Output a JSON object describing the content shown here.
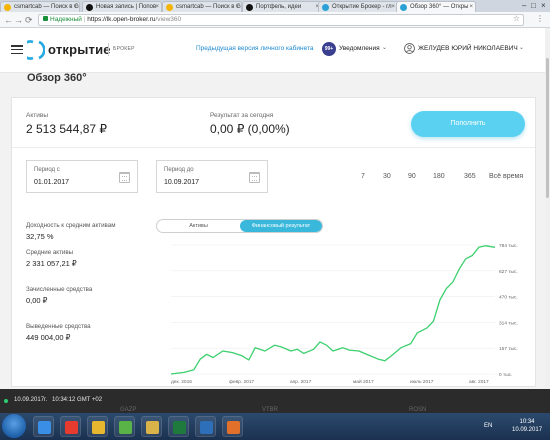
{
  "browser": {
    "tabs": [
      {
        "label": "csmartcab — Поиск в G",
        "active": false,
        "color": "#f4b400"
      },
      {
        "label": "Новая запись | Попов",
        "active": false,
        "color": "#111111"
      },
      {
        "label": "csmartcab — Поиск в G",
        "active": false,
        "color": "#f4b400"
      },
      {
        "label": "Портфель, идеи",
        "active": false,
        "color": "#111111"
      },
      {
        "label": "Открытие Брокер - гл",
        "active": false,
        "color": "#2aa1d6"
      },
      {
        "label": "Обзор 360° — Откры",
        "active": true,
        "color": "#2aa1d6"
      }
    ],
    "tab_close": "×",
    "url_secure_label": "Надежный",
    "url_host": "https://lk.open-broker.ru",
    "url_path": "/view360"
  },
  "header": {
    "logo_text": "открытие",
    "logo_sub": "БРОКЕР",
    "prev_cabinet_link": "Предыдущая версия личного кабинета",
    "notif_badge": "99+",
    "notif_label": "Уведомления",
    "user_name": "ЖЕЛУДЕВ ЮРИЙ НИКОЛАЕВИЧ"
  },
  "page": {
    "title": "Обзор 360°",
    "assets_label": "Активы",
    "assets_value": "2 513 544,87 ₽",
    "result_label": "Результат за сегодня",
    "result_value": "0,00 ₽ (0,00%)",
    "topup_button": "Пополнить",
    "date_from_label": "Период с",
    "date_from_value": "01.01.2017",
    "date_to_label": "Период до",
    "date_to_value": "10.09.2017",
    "periods": [
      "7",
      "30",
      "90",
      "180",
      "365",
      "Всё время"
    ],
    "stats": [
      {
        "label": "Доходность к средним активам",
        "value": "32,75 %"
      },
      {
        "label": "Средние активы",
        "value": "2 331 057,21 ₽"
      },
      {
        "label": "Зачисленные средства",
        "value": "0,00 ₽"
      },
      {
        "label": "Выведенные средства",
        "value": "449 004,00 ₽"
      }
    ],
    "toggle": {
      "assets": "Активы",
      "financial": "Финансовый результат",
      "selected": "financial"
    }
  },
  "chart_data": {
    "type": "line",
    "color": "#3ccf6e",
    "x_labels": [
      "дек. 2016",
      "февр. 2017",
      "апр. 2017",
      "май 2017",
      "июль 2017",
      "авг. 2017"
    ],
    "y_ticks": [
      {
        "value": 0,
        "label": "0 тыс."
      },
      {
        "value": 157,
        "label": "157 тыс."
      },
      {
        "value": 314,
        "label": "314 тыс."
      },
      {
        "value": 470,
        "label": "470 тыс."
      },
      {
        "value": 627,
        "label": "627 тыс."
      },
      {
        "value": 784,
        "label": "784 тыс."
      }
    ],
    "ylim": [
      0,
      784
    ],
    "x_range": [
      0,
      100
    ],
    "points": [
      [
        0,
        0
      ],
      [
        4,
        10
      ],
      [
        7,
        25
      ],
      [
        9,
        90
      ],
      [
        11,
        120
      ],
      [
        13,
        100
      ],
      [
        16,
        140
      ],
      [
        19,
        130
      ],
      [
        22,
        110
      ],
      [
        24,
        85
      ],
      [
        26,
        160
      ],
      [
        29,
        140
      ],
      [
        32,
        175
      ],
      [
        34,
        165
      ],
      [
        37,
        140
      ],
      [
        39,
        150
      ],
      [
        41,
        125
      ],
      [
        44,
        150
      ],
      [
        46,
        195
      ],
      [
        48,
        175
      ],
      [
        50,
        140
      ],
      [
        53,
        160
      ],
      [
        55,
        145
      ],
      [
        58,
        140
      ],
      [
        61,
        115
      ],
      [
        64,
        90
      ],
      [
        66,
        80
      ],
      [
        68,
        110
      ],
      [
        71,
        160
      ],
      [
        74,
        185
      ],
      [
        76,
        250
      ],
      [
        79,
        280
      ],
      [
        81,
        320
      ],
      [
        83,
        450
      ],
      [
        85,
        520
      ],
      [
        87,
        560
      ],
      [
        89,
        640
      ],
      [
        91,
        700
      ],
      [
        93,
        720
      ],
      [
        95,
        770
      ],
      [
        97,
        780
      ],
      [
        100,
        770
      ]
    ]
  },
  "ticker": {
    "date": "10.09.2017г.",
    "time": "10:34:12 GMT +02",
    "symbols": [
      "GAZP",
      "VTBR",
      "ROSN"
    ]
  },
  "taskbar": {
    "apps": [
      {
        "name": "ie-icon",
        "color": "#3a8ee6"
      },
      {
        "name": "yandex-icon",
        "color": "#e63b2e"
      },
      {
        "name": "chrome-icon",
        "color": "#e8b730"
      },
      {
        "name": "utorrent-icon",
        "color": "#59b346"
      },
      {
        "name": "files-icon",
        "color": "#d9b24a"
      },
      {
        "name": "excel-icon",
        "color": "#1f7a3e"
      },
      {
        "name": "folder-icon",
        "color": "#2d6fb8"
      },
      {
        "name": "media-icon",
        "color": "#e0702a"
      }
    ],
    "lang": "EN",
    "clock_time": "10:34",
    "clock_date": "10.09.2017"
  }
}
